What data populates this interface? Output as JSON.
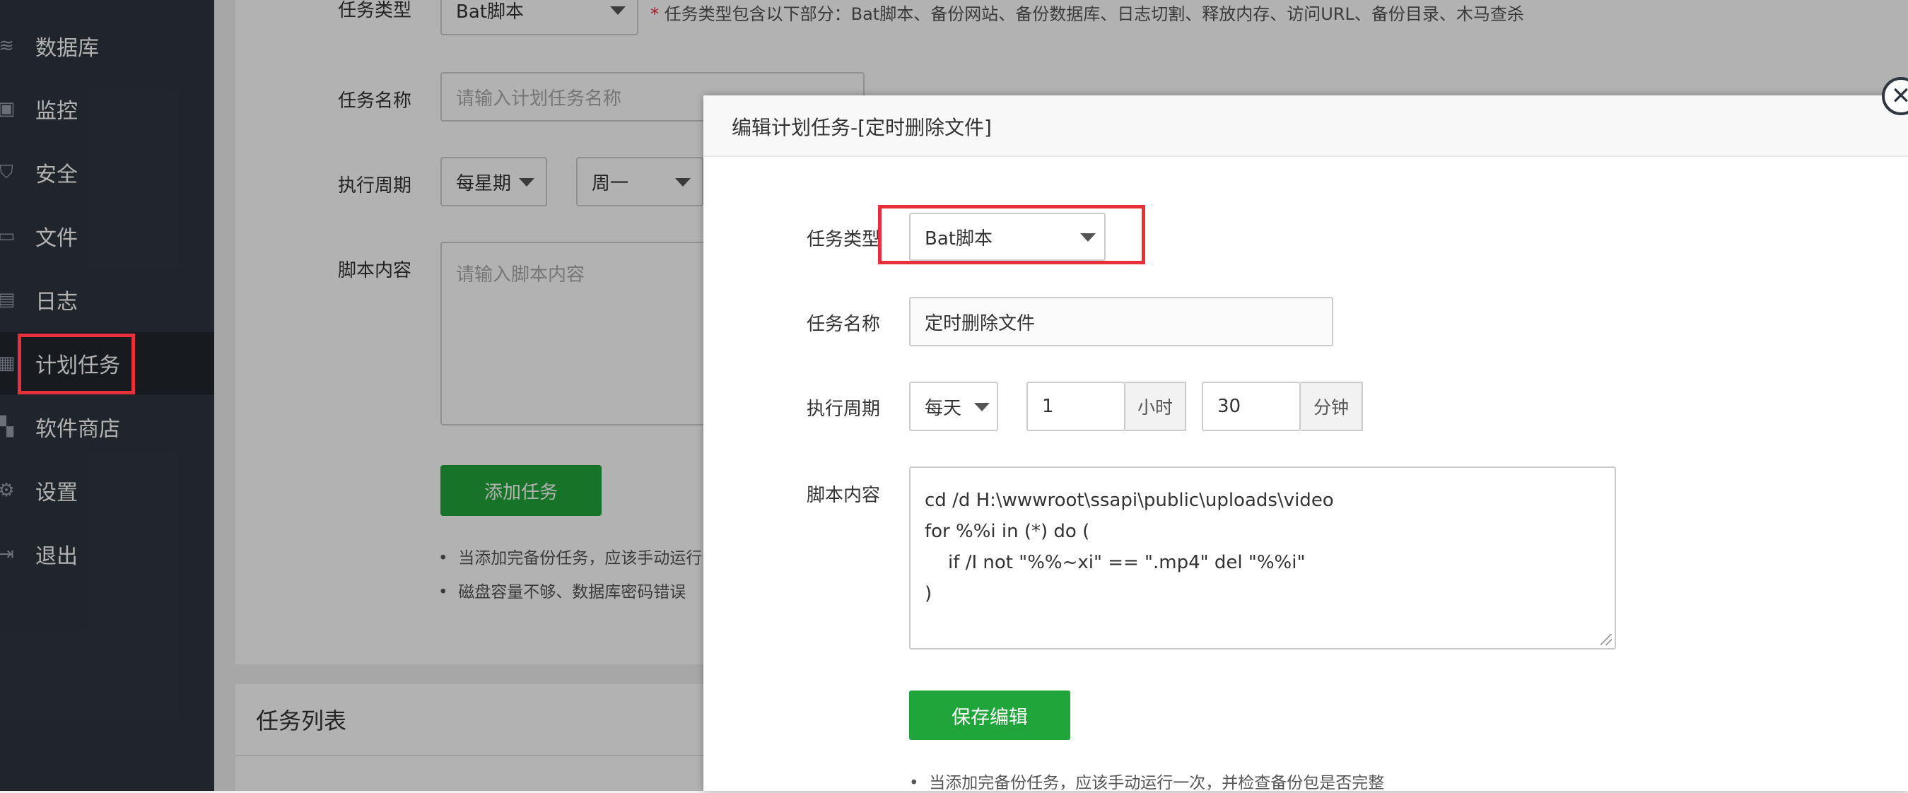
{
  "sidebar": {
    "items": [
      {
        "label": "数据库",
        "icon": "database-icon",
        "glyph": "≋"
      },
      {
        "label": "监控",
        "icon": "monitor-icon",
        "glyph": "▣"
      },
      {
        "label": "安全",
        "icon": "shield-icon",
        "glyph": "⛉"
      },
      {
        "label": "文件",
        "icon": "folder-icon",
        "glyph": "▭"
      },
      {
        "label": "日志",
        "icon": "log-icon",
        "glyph": "▤"
      },
      {
        "label": "计划任务",
        "icon": "calendar-icon",
        "glyph": "▦",
        "active": true
      },
      {
        "label": "软件商店",
        "icon": "apps-icon",
        "glyph": "▚"
      },
      {
        "label": "设置",
        "icon": "gear-icon",
        "glyph": "⚙"
      },
      {
        "label": "退出",
        "icon": "logout-icon",
        "glyph": "⇥"
      }
    ]
  },
  "background_form": {
    "task_type_label": "任务类型",
    "task_type_value": "Bat脚本",
    "task_type_hint": "任务类型包含以下部分：Bat脚本、备份网站、备份数据库、日志切割、释放内存、访问URL、备份目录、木马查杀",
    "task_name_label": "任务名称",
    "task_name_placeholder": "请输入计划任务名称",
    "period_label": "执行周期",
    "period_value": "每星期",
    "weekday_value": "周一",
    "script_label": "脚本内容",
    "script_placeholder": "请输入脚本内容",
    "add_button": "添加任务",
    "notes": [
      "当添加完备份任务，应该手动运行",
      "磁盘容量不够、数据库密码错误"
    ],
    "list_title": "任务列表"
  },
  "modal": {
    "title": "编辑计划任务-[定时删除文件]",
    "task_type_label": "任务类型",
    "task_type_value": "Bat脚本",
    "task_name_label": "任务名称",
    "task_name_value": "定时删除文件",
    "period_label": "执行周期",
    "period_value": "每天",
    "hour_value": "1",
    "hour_unit": "小时",
    "minute_value": "30",
    "minute_unit": "分钟",
    "script_label": "脚本内容",
    "script_value": "cd /d H:\\wwwroot\\ssapi\\public\\uploads\\video\nfor %%i in (*) do (\n    if /I not \"%%~xi\" == \".mp4\" del \"%%i\"\n)",
    "save_button": "保存编辑",
    "note": "当添加完备份任务，应该手动运行一次，并检查备份包是否完整",
    "close_glyph": "✕"
  },
  "colors": {
    "sidebar_bg": "#2f3540",
    "accent_green": "#20a53a",
    "highlight_red": "#e8303a"
  }
}
